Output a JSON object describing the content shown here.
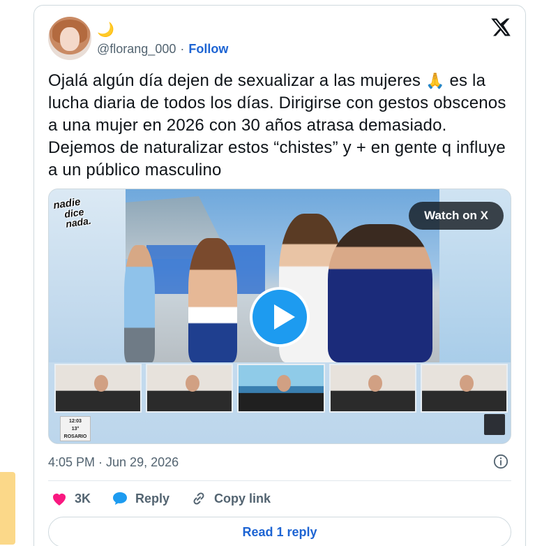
{
  "tweet": {
    "display_name_emoji": "🌙",
    "handle": "@florang_000",
    "separator": "·",
    "follow_label": "Follow",
    "text_part1": "Ojalá algún día dejen de sexualizar a las mujeres ",
    "emoji": "🙏",
    "text_part2": " es la lucha diaria de todos los días. Dirigirse con gestos obscenos a una mujer en 2026 con 30 años atrasa demasiado. Dejemos de naturalizar estos “chistes” y + en gente q influye a un público masculino",
    "timestamp": "4:05 PM · Jun 29, 2026"
  },
  "media": {
    "watch_label": "Watch on X",
    "brand_line1": "nadie",
    "brand_line2": "dice nada.",
    "stat_time": "12:03",
    "stat_temp": "13°",
    "stat_city": "ROSARIO"
  },
  "actions": {
    "like_count": "3K",
    "reply_label": "Reply",
    "copy_label": "Copy link"
  },
  "read_replies_label": "Read 1 reply",
  "colors": {
    "link_blue": "#1d64d3",
    "like_pink": "#f91880",
    "play_blue": "#1d9bf0",
    "text_gray": "#536471"
  }
}
